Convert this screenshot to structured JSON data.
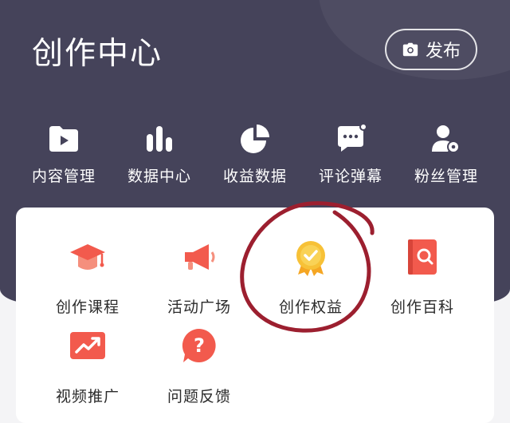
{
  "header": {
    "title": "创作中心",
    "publish_label": "发布"
  },
  "quick_nav": [
    {
      "label": "内容管理",
      "icon": "folder-play-icon"
    },
    {
      "label": "数据中心",
      "icon": "bar-chart-icon"
    },
    {
      "label": "收益数据",
      "icon": "pie-chart-icon"
    },
    {
      "label": "评论弹幕",
      "icon": "comment-icon"
    },
    {
      "label": "粉丝管理",
      "icon": "fans-icon"
    }
  ],
  "tools": [
    {
      "label": "创作课程",
      "icon": "graduation-cap-icon"
    },
    {
      "label": "活动广场",
      "icon": "megaphone-icon"
    },
    {
      "label": "创作权益",
      "icon": "medal-icon"
    },
    {
      "label": "创作百科",
      "icon": "encyclopedia-icon"
    },
    {
      "label": "视频推广",
      "icon": "trend-up-icon"
    },
    {
      "label": "问题反馈",
      "icon": "question-icon"
    }
  ],
  "colors": {
    "header_bg": "#45435a",
    "accent_red": "#f0443c",
    "annotation_circle": "#9c1f2f",
    "medal_gold": "#f7b92a"
  },
  "annotation": {
    "shape": "hand-drawn circle",
    "target": "创作权益"
  }
}
